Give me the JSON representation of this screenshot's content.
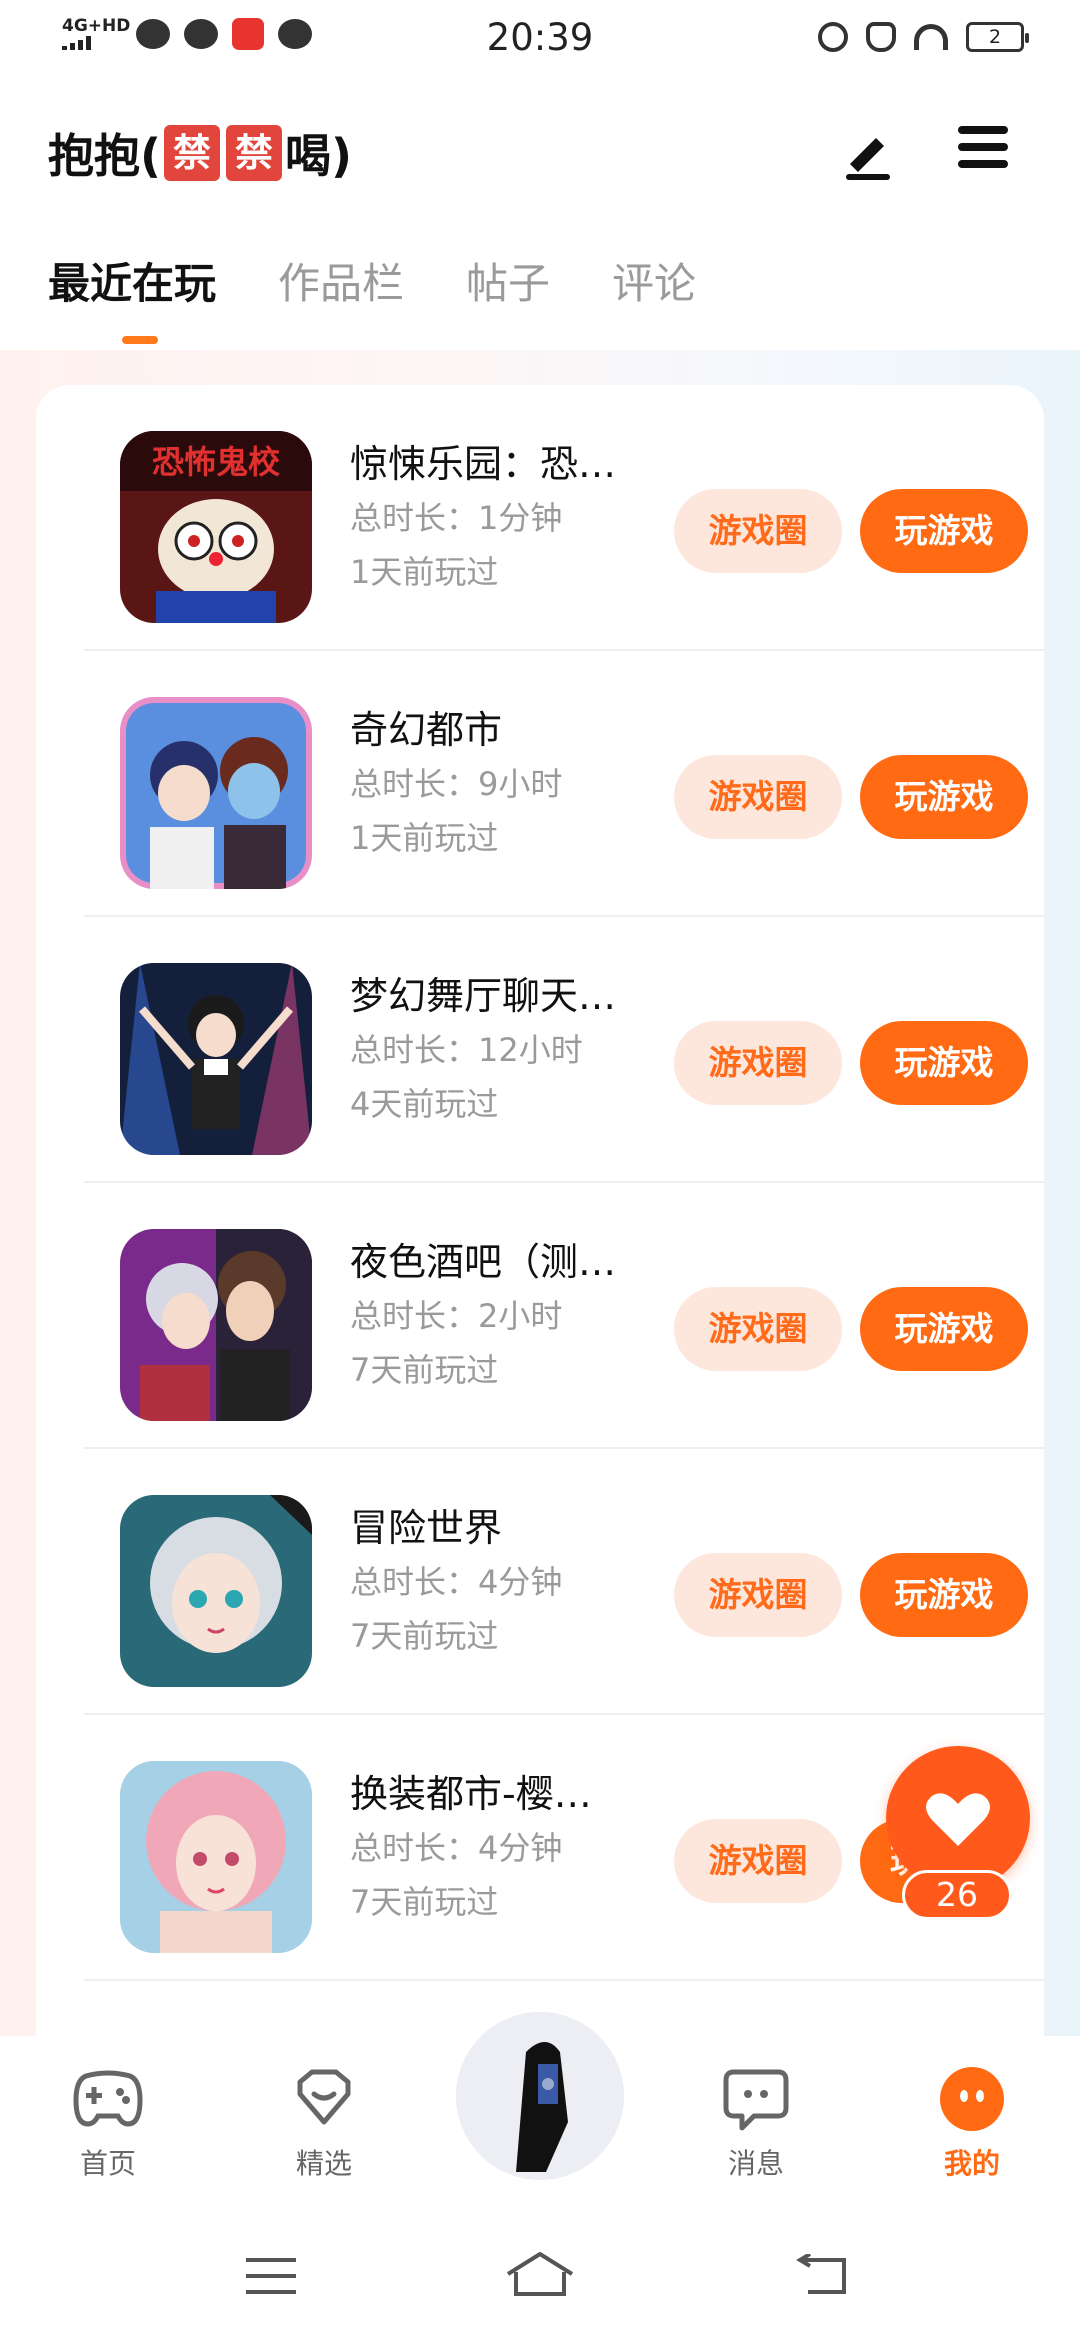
{
  "status_bar": {
    "network": "4G+HD",
    "time": "20:39",
    "battery": "2"
  },
  "header": {
    "title_prefix": "抱抱(",
    "ban_char_1": "禁",
    "ban_char_2": "禁",
    "title_suffix": "喝)"
  },
  "tabs": [
    {
      "label": "最近在玩",
      "active": true
    },
    {
      "label": "作品栏",
      "active": false
    },
    {
      "label": "帖子",
      "active": false
    },
    {
      "label": "评论",
      "active": false
    }
  ],
  "games": [
    {
      "title": "惊悚乐园：恐…",
      "duration": "总时长：1分钟",
      "last_played": "1天前玩过",
      "circle_label": "游戏圈",
      "play_label": "玩游戏"
    },
    {
      "title": "奇幻都市",
      "duration": "总时长：9小时",
      "last_played": "1天前玩过",
      "circle_label": "游戏圈",
      "play_label": "玩游戏"
    },
    {
      "title": "梦幻舞厅聊天…",
      "duration": "总时长：12小时",
      "last_played": "4天前玩过",
      "circle_label": "游戏圈",
      "play_label": "玩游戏"
    },
    {
      "title": "夜色酒吧（测…",
      "duration": "总时长：2小时",
      "last_played": "7天前玩过",
      "circle_label": "游戏圈",
      "play_label": "玩游戏"
    },
    {
      "title": "冒险世界",
      "duration": "总时长：4分钟",
      "last_played": "7天前玩过",
      "circle_label": "游戏圈",
      "play_label": "玩游戏"
    },
    {
      "title": "换装都市-樱…",
      "duration": "总时长：4分钟",
      "last_played": "7天前玩过",
      "circle_label": "游戏圈",
      "play_label": "玩"
    }
  ],
  "thumb_text": {
    "game_1": "恐怖鬼校"
  },
  "like": {
    "count": "26"
  },
  "bottom_nav": [
    {
      "label": "首页",
      "icon": "gamepad-icon",
      "active": false
    },
    {
      "label": "精选",
      "icon": "heart-gem-icon",
      "active": false
    },
    {
      "label": "消息",
      "icon": "chat-bubble-icon",
      "active": false
    },
    {
      "label": "我的",
      "icon": "profile-icon",
      "active": true
    }
  ],
  "colors": {
    "accent": "#ff6a13",
    "accent_light": "#fde7dc",
    "ban_red": "#e2453c"
  }
}
